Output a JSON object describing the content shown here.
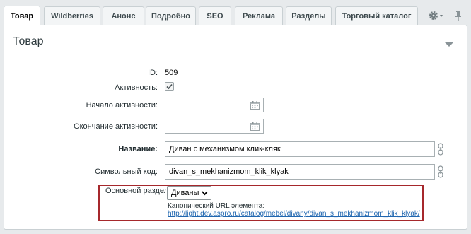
{
  "tabs": [
    {
      "label": "Товар",
      "active": true
    },
    {
      "label": "Wildberries"
    },
    {
      "label": "Анонс"
    },
    {
      "label": "Подробно"
    },
    {
      "label": "SEO"
    },
    {
      "label": "Реклама"
    },
    {
      "label": "Разделы"
    },
    {
      "label": "Торговый каталог"
    }
  ],
  "tab_tools": {
    "settings_icon": "gear-icon",
    "pin_icon": "pin-icon"
  },
  "panel": {
    "title": "Товар",
    "collapse_icon": "chevron-down-icon"
  },
  "form": {
    "id": {
      "label": "ID:",
      "value": "509"
    },
    "active": {
      "label": "Активность:",
      "checked": true
    },
    "active_from": {
      "label": "Начало активности:",
      "value": "",
      "icon": "calendar-icon"
    },
    "active_to": {
      "label": "Окончание активности:",
      "value": "",
      "icon": "calendar-icon"
    },
    "name": {
      "label": "Название:",
      "value": "Диван с механизмом клик-кляк"
    },
    "code": {
      "label": "Символьный код:",
      "value": "divan_s_mekhanizmom_klik_klyak"
    },
    "section": {
      "label": "Основной раздел:",
      "selected": "Диваны",
      "canonical_label": "Канонический URL элемента:",
      "canonical_url": "http://light.dev.aspro.ru/catalog/mebel/divany/divan_s_mekhanizmom_klik_klyak/"
    }
  },
  "colors": {
    "highlight_border": "#a6282c",
    "link": "#2067b0"
  }
}
